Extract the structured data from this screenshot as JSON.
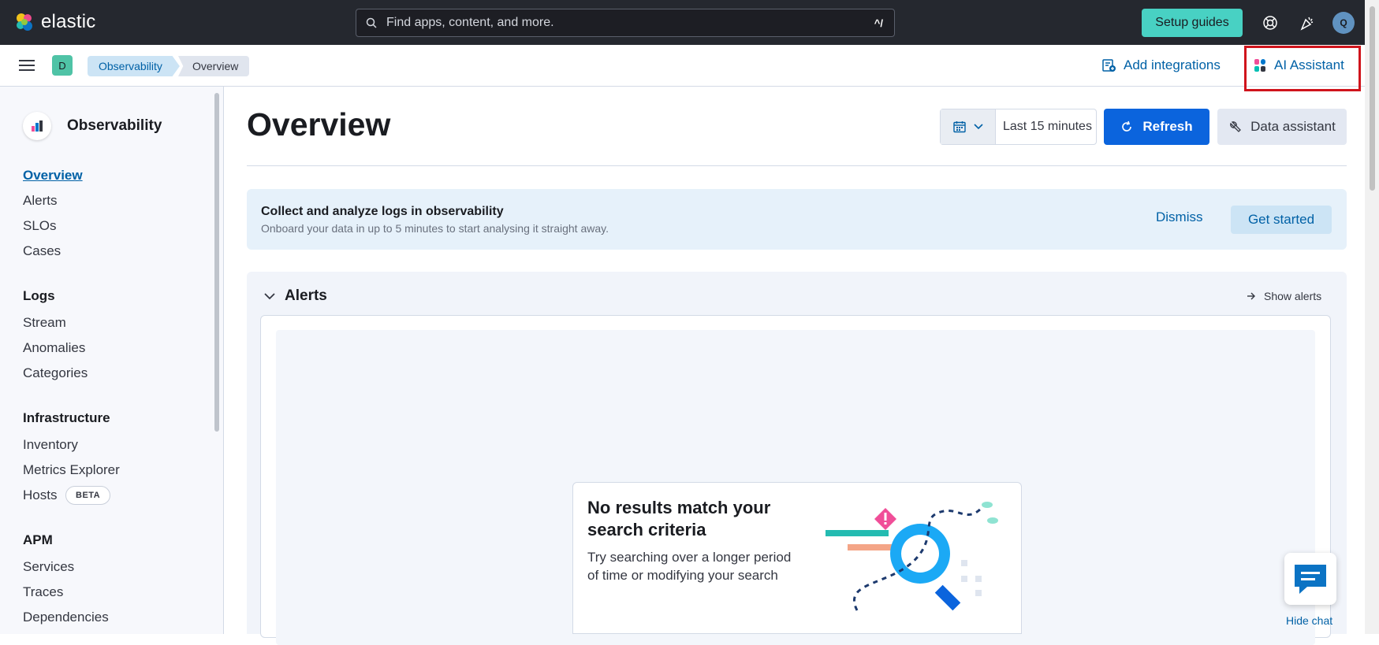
{
  "header": {
    "brand": "elastic",
    "search_placeholder": "Find apps, content, and more.",
    "search_shortcut": "^/",
    "setup_guides": "Setup guides",
    "avatar_initial": "Q",
    "icons": [
      "help-icon",
      "newsfeed-icon"
    ]
  },
  "breadcrumbs": {
    "space_initial": "D",
    "items": [
      "Observability",
      "Overview"
    ],
    "add_integrations": "Add integrations",
    "ai_assistant": "AI Assistant"
  },
  "sidebar": {
    "title": "Observability",
    "top_items": [
      "Overview",
      "Alerts",
      "SLOs",
      "Cases"
    ],
    "active_item": "Overview",
    "groups": [
      {
        "label": "Logs",
        "items": [
          "Stream",
          "Anomalies",
          "Categories"
        ]
      },
      {
        "label": "Infrastructure",
        "items": [
          "Inventory",
          "Metrics Explorer",
          "Hosts"
        ]
      },
      {
        "label": "APM",
        "items": [
          "Services",
          "Traces",
          "Dependencies"
        ]
      }
    ],
    "hosts_badge": "BETA"
  },
  "main": {
    "title": "Overview",
    "date_range": "Last 15 minutes",
    "refresh": "Refresh",
    "data_assistant": "Data assistant",
    "callout": {
      "title": "Collect and analyze logs in observability",
      "text": "Onboard your data in up to 5 minutes to start analysing it straight away.",
      "dismiss": "Dismiss",
      "get_started": "Get started"
    },
    "alerts": {
      "title": "Alerts",
      "show_alerts": "Show alerts",
      "empty_title": "No results match your search criteria",
      "empty_text": "Try searching over a longer period of time or modifying your search"
    }
  },
  "chat": {
    "hide_chat": "Hide chat"
  },
  "colors": {
    "header_bg": "#25282f",
    "primary": "#0b64dd",
    "link": "#0061a6",
    "setup_guides_bg": "#48d1c3",
    "highlight": "#d0141c"
  }
}
